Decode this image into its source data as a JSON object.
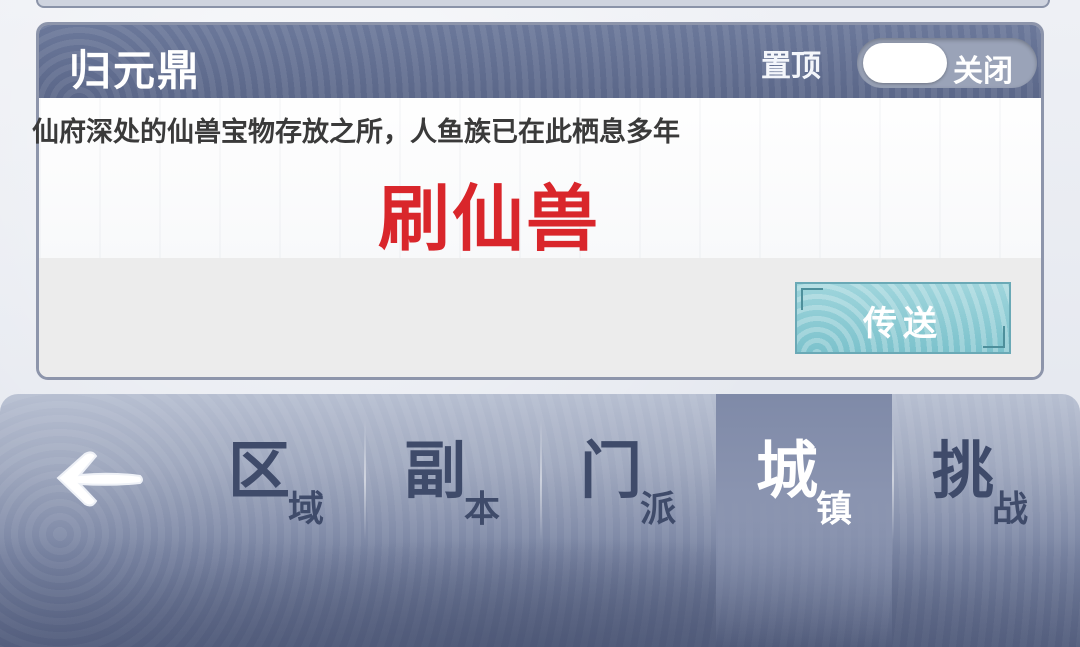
{
  "card": {
    "title": "归元鼎",
    "pin_label": "置顶",
    "toggle_state": "关闭",
    "description": "仙府深处的仙兽宝物存放之所，人鱼族已在此栖息多年",
    "highlight": "刷仙兽",
    "teleport_label": "传送"
  },
  "nav": {
    "back_icon": "arrow-left-icon",
    "tabs": [
      {
        "main": "区",
        "sub": "域"
      },
      {
        "main": "副",
        "sub": "本"
      },
      {
        "main": "门",
        "sub": "派"
      },
      {
        "main": "城",
        "sub": "镇"
      },
      {
        "main": "挑",
        "sub": "战"
      }
    ],
    "active_tab": "城镇"
  },
  "colors": {
    "header": "#5b6789",
    "highlight": "#d9262b",
    "teleport": "#7cc2cc",
    "nav_text": "#3f4b6a"
  }
}
